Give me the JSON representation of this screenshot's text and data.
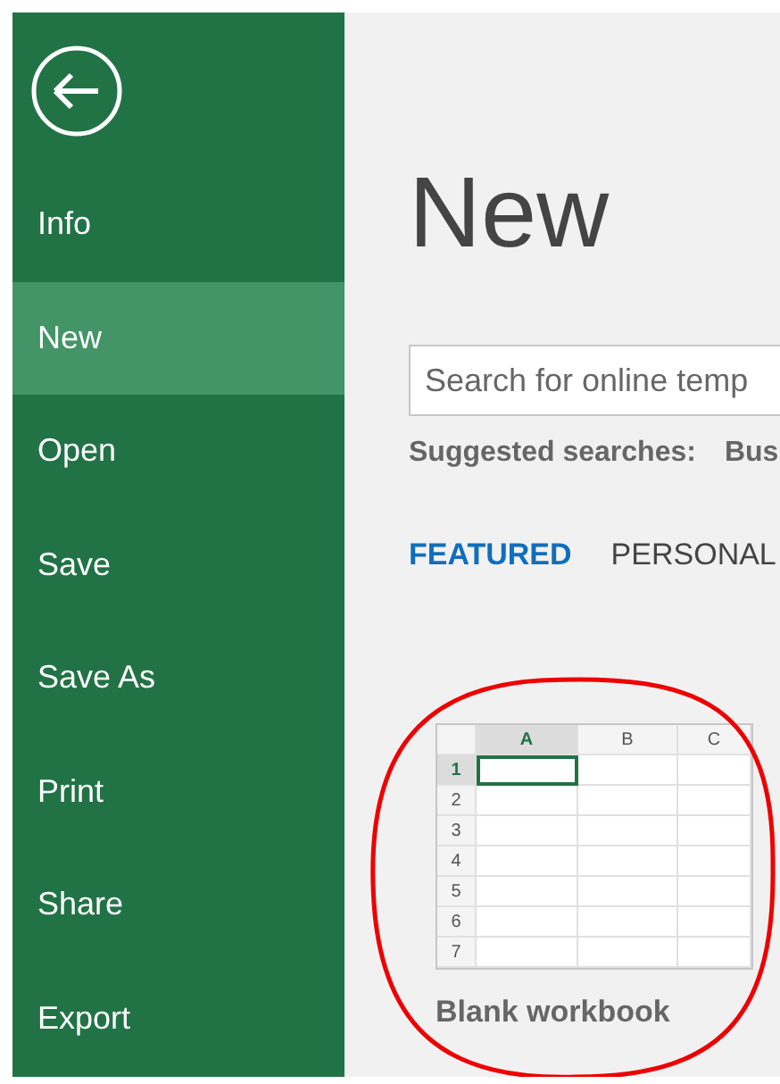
{
  "sidebar": {
    "items": [
      {
        "label": "Info",
        "selected": false
      },
      {
        "label": "New",
        "selected": true
      },
      {
        "label": "Open",
        "selected": false
      },
      {
        "label": "Save",
        "selected": false
      },
      {
        "label": "Save As",
        "selected": false
      },
      {
        "label": "Print",
        "selected": false
      },
      {
        "label": "Share",
        "selected": false
      },
      {
        "label": "Export",
        "selected": false
      }
    ]
  },
  "page_title": "New",
  "search": {
    "placeholder": "Search for online temp"
  },
  "suggested": {
    "label": "Suggested searches:",
    "items": [
      "Bus"
    ]
  },
  "tabs": [
    {
      "label": "FEATURED",
      "selected": true
    },
    {
      "label": "PERSONAL",
      "selected": false
    }
  ],
  "template": {
    "label": "Blank workbook",
    "columns": [
      {
        "label": "A",
        "selected": true
      },
      {
        "label": "B",
        "selected": false
      },
      {
        "label": "C",
        "selected": false
      }
    ],
    "rows": [
      {
        "label": "1",
        "selected": true
      },
      {
        "label": "2",
        "selected": false
      },
      {
        "label": "3",
        "selected": false
      },
      {
        "label": "4",
        "selected": false
      },
      {
        "label": "5",
        "selected": false
      },
      {
        "label": "6",
        "selected": false
      },
      {
        "label": "7",
        "selected": false
      }
    ]
  }
}
